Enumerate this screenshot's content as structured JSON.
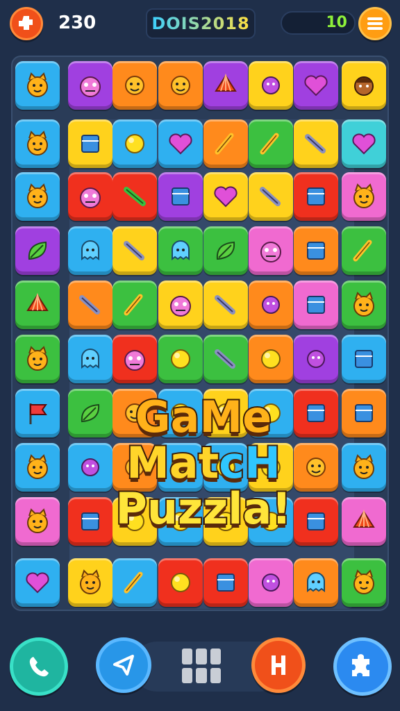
{
  "header": {
    "score": "230",
    "title": "DOIS2018",
    "moves": "10",
    "settings_icon": "puzzle-gear-icon",
    "menu_icon": "hamburger-menu-icon"
  },
  "logo": {
    "line1": "GaMe",
    "line2a": "Mat",
    "line2b": "cH",
    "line3": "Puzzla!"
  },
  "footer": {
    "call_icon": "phone-icon",
    "send_icon": "send-arrow-icon",
    "grid_icon": "grid-icon",
    "h_icon": "h-letter-icon",
    "puzzle_icon": "puzzle-piece-icon"
  },
  "colors": {
    "yellow": "#ffd21c",
    "orange": "#ff8a1c",
    "red": "#f0301e",
    "purple": "#a040e0",
    "blue": "#2fb0f0",
    "green": "#3cc040",
    "pink": "#f06ad0",
    "teal": "#40d0d8"
  },
  "tiles": [
    [
      "blue",
      "cat"
    ],
    [
      "purple",
      "monster"
    ],
    [
      "orange",
      "sun"
    ],
    [
      "orange",
      "sun"
    ],
    [
      "purple",
      "shell"
    ],
    [
      "yellow",
      "flower"
    ],
    [
      "purple",
      "heart"
    ],
    [
      "yellow",
      "face"
    ],
    [
      "blue",
      "cat"
    ],
    [
      "yellow",
      "box"
    ],
    [
      "blue",
      "ball"
    ],
    [
      "blue",
      "heart"
    ],
    [
      "orange",
      "bone"
    ],
    [
      "green",
      "bone"
    ],
    [
      "yellow",
      "tool"
    ],
    [
      "teal",
      "heart"
    ],
    [
      "blue",
      "cat"
    ],
    [
      "red",
      "monster"
    ],
    [
      "red",
      "stick"
    ],
    [
      "purple",
      "box"
    ],
    [
      "yellow",
      "heart"
    ],
    [
      "yellow",
      "tool"
    ],
    [
      "red",
      "box"
    ],
    [
      "pink",
      "cat"
    ],
    [
      "purple",
      "leaf"
    ],
    [
      "blue",
      "ghost"
    ],
    [
      "yellow",
      "tool"
    ],
    [
      "green",
      "ghost"
    ],
    [
      "green",
      "leaf"
    ],
    [
      "pink",
      "monster"
    ],
    [
      "orange",
      "box"
    ],
    [
      "green",
      "bone"
    ],
    [
      "green",
      "shell"
    ],
    [
      "orange",
      "tool"
    ],
    [
      "green",
      "bone"
    ],
    [
      "yellow",
      "monster"
    ],
    [
      "yellow",
      "tool"
    ],
    [
      "orange",
      "flower"
    ],
    [
      "pink",
      "box"
    ],
    [
      "green",
      "cat"
    ],
    [
      "green",
      "cat"
    ],
    [
      "blue",
      "ghost"
    ],
    [
      "red",
      "monster"
    ],
    [
      "green",
      "ball"
    ],
    [
      "green",
      "tool"
    ],
    [
      "orange",
      "ball"
    ],
    [
      "purple",
      "flower"
    ],
    [
      "blue",
      "box"
    ],
    [
      "blue",
      "flag"
    ],
    [
      "green",
      "leaf"
    ],
    [
      "orange",
      "sun"
    ],
    [
      "blue",
      "ball"
    ],
    [
      "yellow",
      "ball"
    ],
    [
      "blue",
      "ball"
    ],
    [
      "red",
      "box"
    ],
    [
      "orange",
      "box"
    ],
    [
      "blue",
      "cat"
    ],
    [
      "blue",
      "flower"
    ],
    [
      "orange",
      "sun"
    ],
    [
      "blue",
      "ball"
    ],
    [
      "blue",
      "ball"
    ],
    [
      "yellow",
      "ball"
    ],
    [
      "orange",
      "sun"
    ],
    [
      "blue",
      "cat"
    ],
    [
      "pink",
      "cat"
    ],
    [
      "red",
      "box"
    ],
    [
      "yellow",
      "ball"
    ],
    [
      "blue",
      "ball"
    ],
    [
      "yellow",
      "ball"
    ],
    [
      "blue",
      "ball"
    ],
    [
      "red",
      "box"
    ],
    [
      "pink",
      "shell"
    ],
    [
      "blue",
      "heart"
    ],
    [
      "yellow",
      "cat"
    ],
    [
      "blue",
      "bone"
    ],
    [
      "red",
      "ball"
    ],
    [
      "red",
      "box"
    ],
    [
      "pink",
      "flower"
    ],
    [
      "orange",
      "ghost"
    ],
    [
      "green",
      "cat"
    ]
  ]
}
